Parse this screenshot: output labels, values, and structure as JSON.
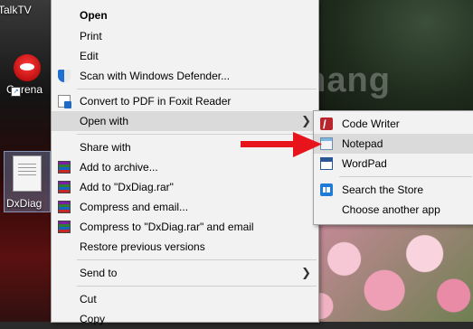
{
  "desktop": {
    "icons": [
      {
        "label": "TalkTV"
      },
      {
        "label": "Garena"
      },
      {
        "label": "DxDiag"
      }
    ],
    "watermark": "uantrimang"
  },
  "context_menu": {
    "items": [
      {
        "label": "Open"
      },
      {
        "label": "Print"
      },
      {
        "label": "Edit"
      },
      {
        "label": "Scan with Windows Defender..."
      },
      {
        "label": "Convert to PDF in Foxit Reader"
      },
      {
        "label": "Open with"
      },
      {
        "label": "Share with"
      },
      {
        "label": "Add to archive..."
      },
      {
        "label": "Add to \"DxDiag.rar\""
      },
      {
        "label": "Compress and email..."
      },
      {
        "label": "Compress to \"DxDiag.rar\" and email"
      },
      {
        "label": "Restore previous versions"
      },
      {
        "label": "Send to"
      },
      {
        "label": "Cut"
      },
      {
        "label": "Copy"
      }
    ]
  },
  "open_with_submenu": {
    "items": [
      {
        "label": "Code Writer"
      },
      {
        "label": "Notepad"
      },
      {
        "label": "WordPad"
      },
      {
        "label": "Search the Store"
      },
      {
        "label": "Choose another app"
      }
    ]
  },
  "icons": {
    "shield": "windows-defender-shield-icon",
    "pdf": "foxit-pdf-icon",
    "archive": "winrar-archive-icon",
    "chevron": "chevron-right-icon",
    "code_writer": "code-writer-icon",
    "notepad": "notepad-icon",
    "wordpad": "wordpad-icon",
    "store": "store-icon"
  },
  "colors": {
    "menu_bg": "#f2f2f2",
    "highlight": "#dadada",
    "annotation_arrow": "#e8141c"
  }
}
